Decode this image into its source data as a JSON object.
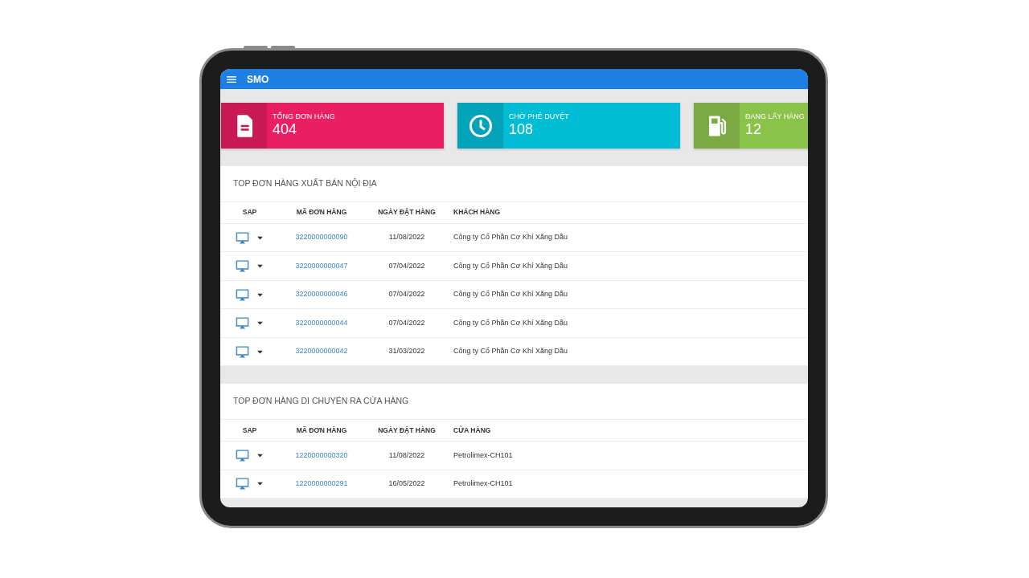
{
  "app_bar": {
    "title": "SMO"
  },
  "stat_cards": [
    {
      "kind": "document",
      "label": "TỔNG ĐƠN HÀNG",
      "value": "404",
      "color": "#e91e63"
    },
    {
      "kind": "clock",
      "label": "CHỜ PHÊ DUYỆT",
      "value": "108",
      "color": "#00bcd4"
    },
    {
      "kind": "fuel",
      "label": "ĐANG LẤY HÀNG",
      "value": "12",
      "color": "#8bc34a"
    }
  ],
  "sections": [
    {
      "title": "TOP ĐƠN HÀNG XUẤT BÁN NỘI ĐỊA",
      "columns": [
        "SAP",
        "MÃ ĐƠN HÀNG",
        "NGÀY ĐẶT HÀNG",
        "KHÁCH HÀNG"
      ],
      "rows": [
        {
          "order_id": "3220000000090",
          "date": "11/08/2022",
          "party": "Công ty Cổ Phần Cơ Khí Xăng Dầu"
        },
        {
          "order_id": "3220000000047",
          "date": "07/04/2022",
          "party": "Công ty Cổ Phần Cơ Khí Xăng Dầu"
        },
        {
          "order_id": "3220000000046",
          "date": "07/04/2022",
          "party": "Công ty Cổ Phần Cơ Khí Xăng Dầu"
        },
        {
          "order_id": "3220000000044",
          "date": "07/04/2022",
          "party": "Công ty Cổ Phần Cơ Khí Xăng Dầu"
        },
        {
          "order_id": "3220000000042",
          "date": "31/03/2022",
          "party": "Công ty Cổ Phần Cơ Khí Xăng Dầu"
        }
      ]
    },
    {
      "title": "TOP ĐƠN HÀNG DI CHUYỂN RA CỬA HÀNG",
      "columns": [
        "SAP",
        "MÃ ĐƠN HÀNG",
        "NGÀY ĐẶT HÀNG",
        "CỬA HÀNG"
      ],
      "rows": [
        {
          "order_id": "1220000000320",
          "date": "11/08/2022",
          "party": "Petrolimex-CH101"
        },
        {
          "order_id": "1220000000291",
          "date": "16/05/2022",
          "party": "Petrolimex-CH101"
        }
      ]
    }
  ]
}
